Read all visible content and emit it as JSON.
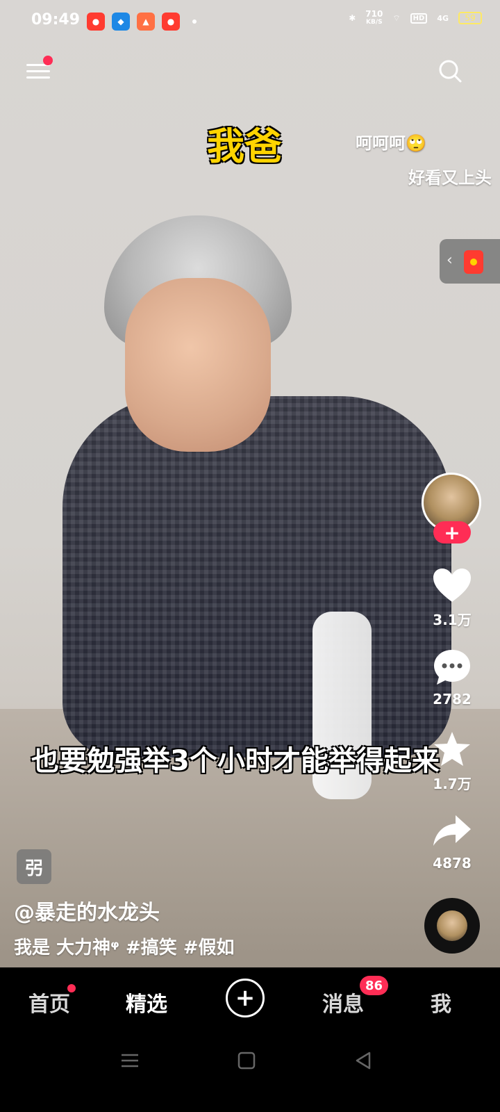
{
  "status_bar": {
    "time": "09:49",
    "network_speed_value": "710",
    "network_speed_unit": "KB/S",
    "hd_label": "HD",
    "signal_label": "4G",
    "battery": "59"
  },
  "overlay": {
    "caption_top": "我爸",
    "danmaku": [
      "呵呵呵🙄",
      "好看又上头"
    ],
    "subtitle": "也要勉强举3个小时才能举得起来"
  },
  "actions": {
    "likes": "3.1万",
    "comments": "2782",
    "favorites": "1.7万",
    "shares": "4878"
  },
  "post": {
    "tag_glyph": "弜",
    "username": "@暴走的水龙头",
    "description": "我是 大力神ᵠ #搞笑 #假如"
  },
  "tabs": {
    "home": "首页",
    "featured": "精选",
    "create": "+",
    "messages": "消息",
    "messages_badge": "86",
    "me": "我"
  },
  "colors": {
    "accent": "#ff2d55",
    "caption_yellow": "#ffd400",
    "battery": "#ffea63"
  }
}
